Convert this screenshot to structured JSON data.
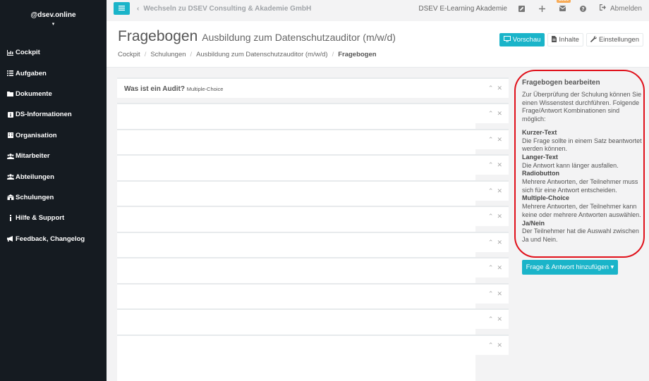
{
  "sidebar": {
    "user": "@dsev.online",
    "caret": "▾",
    "items": [
      {
        "label": "Cockpit",
        "icon": "chart-icon"
      },
      {
        "label": "Aufgaben",
        "icon": "list-icon"
      },
      {
        "label": "Dokumente",
        "icon": "folder-icon"
      },
      {
        "label": "DS-Informationen",
        "icon": "info-square-icon"
      },
      {
        "label": "Organisation",
        "icon": "building-icon"
      },
      {
        "label": "Mitarbeiter",
        "icon": "users-icon"
      },
      {
        "label": "Abteilungen",
        "icon": "users-icon"
      },
      {
        "label": "Schulungen",
        "icon": "school-icon"
      },
      {
        "label": "Hilfe & Support",
        "icon": "info-icon"
      },
      {
        "label": "Feedback, Changelog",
        "icon": "megaphone-icon"
      }
    ]
  },
  "topbar": {
    "switch_label": "Wechseln zu DSEV Consulting & Akademie GmbH",
    "tenant": "DSEV E-Learning Akademie",
    "badge": "1930",
    "logout": "Abmelden"
  },
  "header": {
    "title": "Fragebogen",
    "subtitle": "Ausbildung zum Datenschutzauditor (m/w/d)",
    "breadcrumb": [
      "Cockpit",
      "Schulungen",
      "Ausbildung zum Datenschutzauditor (m/w/d)",
      "Fragebogen"
    ],
    "buttons": {
      "preview": "Vorschau",
      "contents": "Inhalte",
      "settings": "Einstellungen"
    }
  },
  "questions": {
    "first_title": "Was ist ein Audit?",
    "first_type": "Multiple-Choice",
    "collapse_glyph": "⌃",
    "close_glyph": "✕"
  },
  "panel": {
    "title": "Fragebogen bearbeiten",
    "intro": "Zur Überprüfung der Schulung können Sie einen Wissenstest durchführen. Folgende Frage/Antwort Kombinationen sind möglich:",
    "types": [
      {
        "name": "Kurzer-Text",
        "desc": "Die Frage sollte in einem Satz beantwortet werden können."
      },
      {
        "name": "Langer-Text",
        "desc": "Die Antwort kann länger ausfallen."
      },
      {
        "name": "Radiobutton",
        "desc": "Mehrere Antworten, der Teilnehmer muss sich für eine Antwort entscheiden."
      },
      {
        "name": "Multiple-Choice",
        "desc": "Mehrere Antworten, der Teilnehmer kann keine oder mehrere Antworten auswählen."
      },
      {
        "name": "Ja/Nein",
        "desc": "Der Teilnehmer hat die Auswahl zwischen Ja und Nein."
      }
    ],
    "add_button": "Frage & Antwort hinzufügen ▾"
  },
  "colors": {
    "accent": "#1ab4c9",
    "sidebar": "#151b21",
    "highlight": "#e0101a",
    "badge": "#f8ac59"
  }
}
